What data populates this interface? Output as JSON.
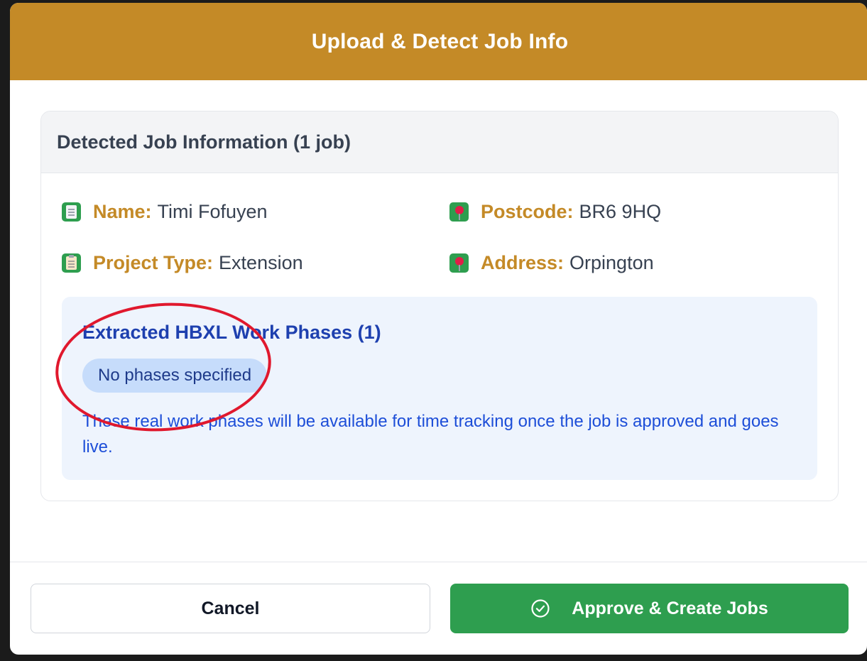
{
  "modal": {
    "title": "Upload & Detect Job Info"
  },
  "card": {
    "title": "Detected Job Information (1 job)"
  },
  "fields": {
    "name": {
      "label": "Name:",
      "value": "Timi Fofuyen",
      "icon": "document-icon"
    },
    "project_type": {
      "label": "Project Type:",
      "value": "Extension",
      "icon": "clipboard-icon"
    },
    "postcode": {
      "label": "Postcode:",
      "value": "BR6 9HQ",
      "icon": "pushpin-icon"
    },
    "address": {
      "label": "Address:",
      "value": "Orpington",
      "icon": "pushpin-icon"
    }
  },
  "phases": {
    "title": "Extracted HBXL Work Phases (1)",
    "chips": [
      "No phases specified"
    ],
    "note": "These real work phases will be available for time tracking once the job is approved and goes live."
  },
  "footer": {
    "cancel_label": "Cancel",
    "approve_label": "Approve & Create Jobs"
  },
  "colors": {
    "header": "#c48a27",
    "approve": "#2e9e4f",
    "phases_text": "#1e40af",
    "annotation": "#e0182d"
  }
}
